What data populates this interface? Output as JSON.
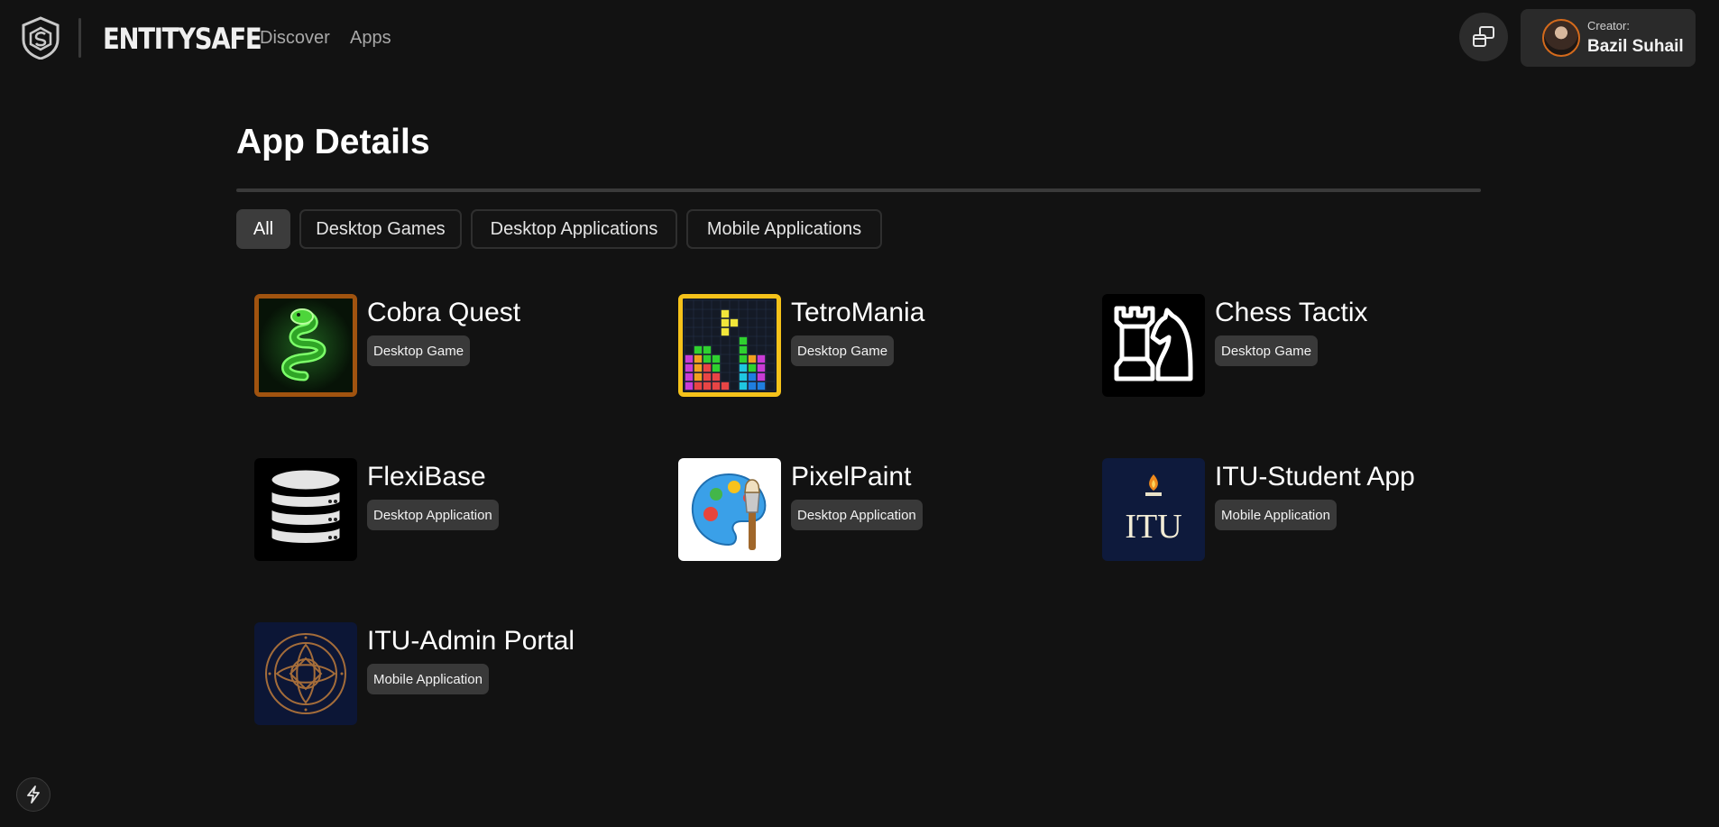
{
  "header": {
    "brand": "ENTITYSAFE",
    "nav": [
      {
        "label": "Discover"
      },
      {
        "label": "Apps"
      }
    ],
    "creator": {
      "label": "Creator:",
      "name": "Bazil Suhail"
    }
  },
  "main": {
    "title": "App Details",
    "filters": [
      {
        "label": "All",
        "active": true
      },
      {
        "label": "Desktop Games",
        "active": false
      },
      {
        "label": "Desktop Applications",
        "active": false
      },
      {
        "label": "Mobile Applications",
        "active": false
      }
    ],
    "apps": [
      {
        "name": "Cobra Quest",
        "category": "Desktop Game",
        "icon": "snake-icon"
      },
      {
        "name": "TetroMania",
        "category": "Desktop Game",
        "icon": "tetris-blocks-icon"
      },
      {
        "name": "Chess Tactix",
        "category": "Desktop Game",
        "icon": "chess-rook-knight-icon"
      },
      {
        "name": "FlexiBase",
        "category": "Desktop Application",
        "icon": "database-icon"
      },
      {
        "name": "PixelPaint",
        "category": "Desktop Application",
        "icon": "paint-palette-icon"
      },
      {
        "name": "ITU-Student App",
        "category": "Mobile Application",
        "icon": "itu-logo-icon",
        "logo_text": "ITU"
      },
      {
        "name": "ITU-Admin Portal",
        "category": "Mobile Application",
        "icon": "itu-seal-icon"
      }
    ]
  }
}
